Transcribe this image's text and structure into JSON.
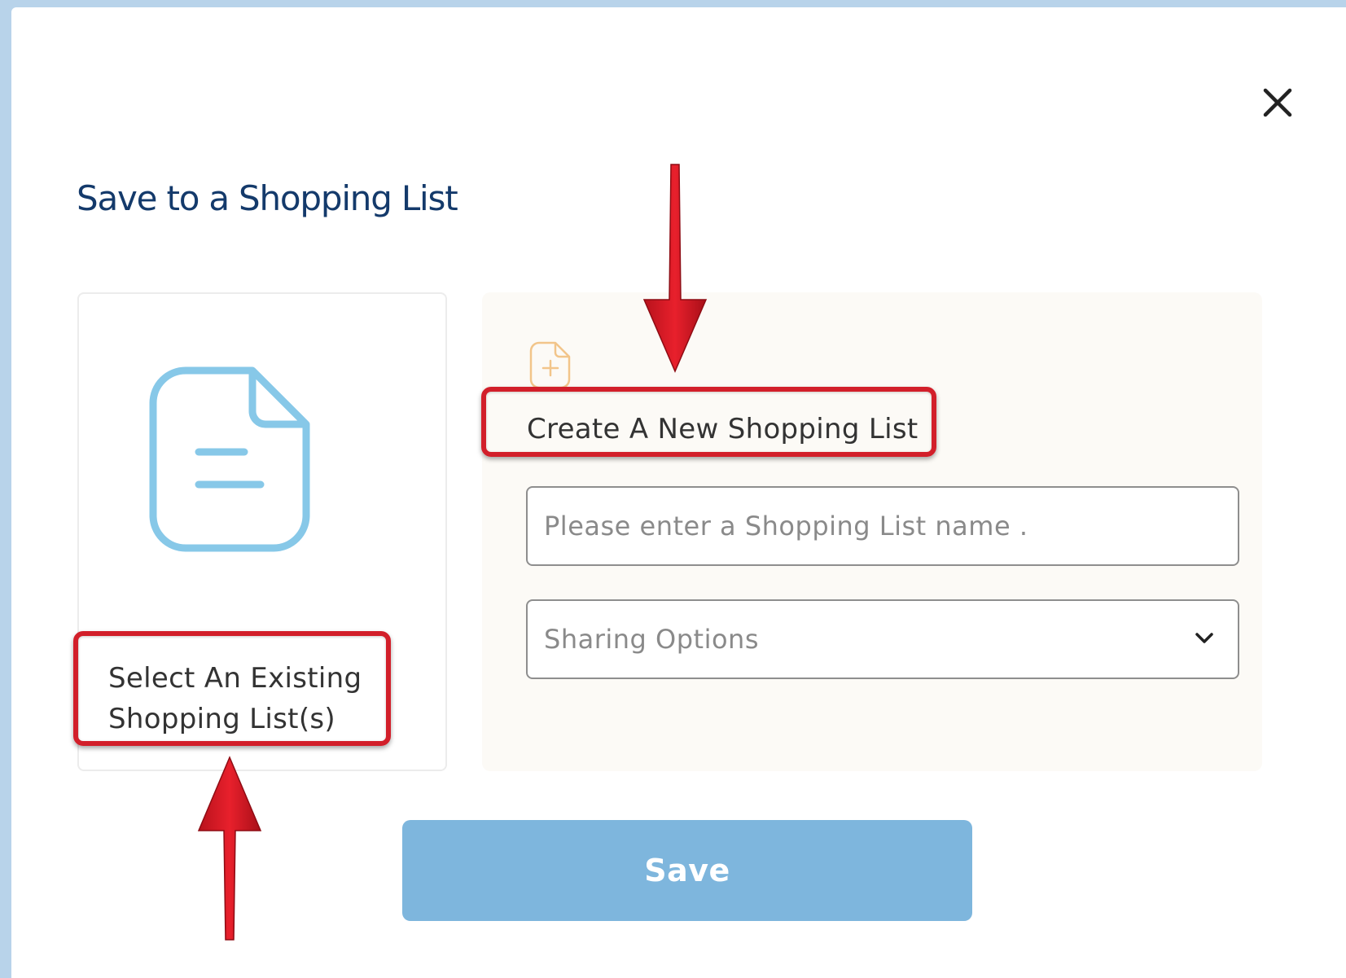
{
  "dialog": {
    "title": "Save to a Shopping List",
    "close_icon": "close-icon"
  },
  "existing_list": {
    "icon": "document-icon",
    "label_line1": "Select An Existing",
    "label_line2": "Shopping List(s)"
  },
  "new_list": {
    "icon": "add-document-icon",
    "label": "Create A New Shopping List",
    "name_input": {
      "value": "",
      "placeholder": "Please enter a Shopping List name ."
    },
    "sharing_select": {
      "selected": "Sharing Options",
      "icon": "chevron-down-icon"
    }
  },
  "actions": {
    "save_label": "Save"
  },
  "annotations": {
    "highlight_color": "#d21f2a",
    "arrow_icon": "red-arrow-icon"
  },
  "colors": {
    "title": "#143a6b",
    "save_button": "#7eb6dd",
    "document_icon": "#87c8e8",
    "add_document_icon": "#f2c58a",
    "new_list_panel": "#fcfaf6",
    "backdrop": "#b8d3ea"
  }
}
